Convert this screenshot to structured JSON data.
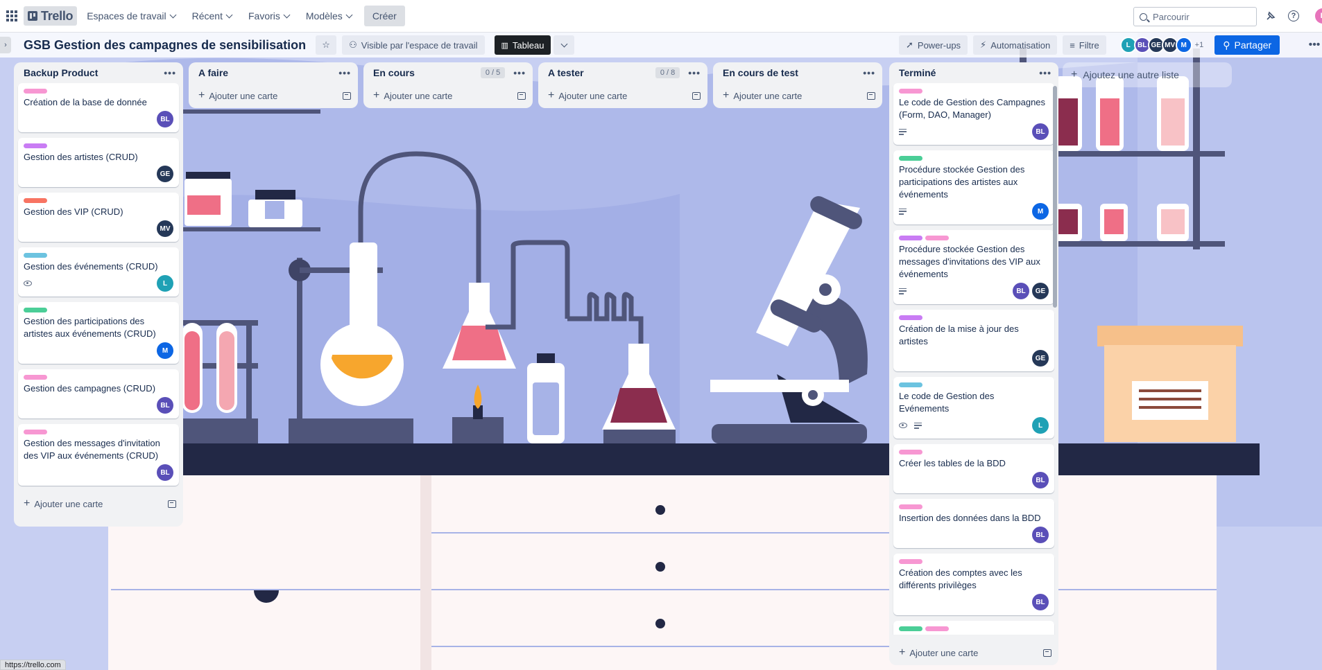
{
  "header": {
    "logo_text": "Trello",
    "nav": [
      {
        "label": "Espaces de travail"
      },
      {
        "label": "Récent"
      },
      {
        "label": "Favoris"
      },
      {
        "label": "Modèles"
      }
    ],
    "create_label": "Créer",
    "search_placeholder": "Parcourir",
    "user_initial": "L"
  },
  "board": {
    "title": "GSB Gestion des campagnes de sensibilisation",
    "visibility_label": "Visible par l'espace de travail",
    "view_tab_label": "Tableau",
    "powerups_label": "Power-ups",
    "automation_label": "Automatisation",
    "filter_label": "Filtre",
    "members": [
      {
        "initials": "L",
        "color": "#1fa1b5"
      },
      {
        "initials": "BL",
        "color": "#5a4fb8"
      },
      {
        "initials": "GE",
        "color": "#253858"
      },
      {
        "initials": "MV",
        "color": "#253858"
      },
      {
        "initials": "M",
        "color": "#0c66e4"
      }
    ],
    "members_more": "+1",
    "share_label": "Partager",
    "add_list_label": "Ajoutez une autre liste"
  },
  "add_card_label": "Ajouter une carte",
  "lists": [
    {
      "name": "Backup Product",
      "count": "",
      "cards": [
        {
          "labels": [
            "#f797d2"
          ],
          "title": "Création de la base de donnée",
          "badges": [],
          "members": [
            {
              "initials": "BL",
              "color": "#5a4fb8"
            }
          ]
        },
        {
          "labels": [
            "#c97cf4"
          ],
          "title": "Gestion des artistes (CRUD)",
          "badges": [],
          "members": [
            {
              "initials": "GE",
              "color": "#253858"
            }
          ]
        },
        {
          "labels": [
            "#f87462"
          ],
          "title": "Gestion des VIP (CRUD)",
          "badges": [],
          "members": [
            {
              "initials": "MV",
              "color": "#253858"
            }
          ]
        },
        {
          "labels": [
            "#6cc3e0"
          ],
          "title": "Gestion des événements (CRUD)",
          "badges": [
            "eye"
          ],
          "members": [
            {
              "initials": "L",
              "color": "#1fa1b5"
            }
          ]
        },
        {
          "labels": [
            "#4bce97"
          ],
          "title": "Gestion des participations des artistes aux événements (CRUD)",
          "badges": [],
          "members": [
            {
              "initials": "M",
              "color": "#0c66e4"
            }
          ]
        },
        {
          "labels": [
            "#f797d2"
          ],
          "title": "Gestion des campagnes (CRUD)",
          "badges": [],
          "members": [
            {
              "initials": "BL",
              "color": "#5a4fb8"
            }
          ]
        },
        {
          "labels": [
            "#f797d2"
          ],
          "title": "Gestion des messages d'invitation des VIP aux événements (CRUD)",
          "badges": [],
          "members": [
            {
              "initials": "BL",
              "color": "#5a4fb8"
            }
          ]
        }
      ]
    },
    {
      "name": "A faire",
      "count": "",
      "cards": []
    },
    {
      "name": "En cours",
      "count": "0 / 5",
      "cards": []
    },
    {
      "name": "A tester",
      "count": "0 / 8",
      "cards": []
    },
    {
      "name": "En cours de test",
      "count": "",
      "cards": []
    },
    {
      "name": "Terminé",
      "count": "",
      "cards": [
        {
          "labels": [
            "#f797d2"
          ],
          "title": "Le code de Gestion des Campagnes (Form, DAO, Manager)",
          "badges": [
            "desc"
          ],
          "members": [
            {
              "initials": "BL",
              "color": "#5a4fb8"
            }
          ]
        },
        {
          "labels": [
            "#4bce97"
          ],
          "title": "Procédure stockée Gestion des participations des artistes aux événements",
          "badges": [
            "desc"
          ],
          "members": [
            {
              "initials": "M",
              "color": "#0c66e4"
            }
          ]
        },
        {
          "labels": [
            "#c97cf4",
            "#f797d2"
          ],
          "title": "Procédure stockée Gestion des messages d'invitations des VIP aux événements",
          "badges": [
            "desc"
          ],
          "members": [
            {
              "initials": "BL",
              "color": "#5a4fb8"
            },
            {
              "initials": "GE",
              "color": "#253858"
            }
          ]
        },
        {
          "labels": [
            "#c97cf4"
          ],
          "title": "Création de la mise à jour des artistes",
          "badges": [],
          "members": [
            {
              "initials": "GE",
              "color": "#253858"
            }
          ]
        },
        {
          "labels": [
            "#6cc3e0"
          ],
          "title": "Le code de Gestion des Evénements",
          "badges": [
            "eye",
            "desc"
          ],
          "members": [
            {
              "initials": "L",
              "color": "#1fa1b5"
            }
          ]
        },
        {
          "labels": [
            "#f797d2"
          ],
          "title": "Créer les tables de la BDD",
          "badges": [],
          "members": [
            {
              "initials": "BL",
              "color": "#5a4fb8"
            }
          ]
        },
        {
          "labels": [
            "#f797d2"
          ],
          "title": "Insertion des données dans la BDD",
          "badges": [],
          "members": [
            {
              "initials": "BL",
              "color": "#5a4fb8"
            }
          ]
        },
        {
          "labels": [
            "#f797d2"
          ],
          "title": "Création des comptes avec les différents privilèges",
          "badges": [],
          "members": [
            {
              "initials": "BL",
              "color": "#5a4fb8"
            }
          ]
        },
        {
          "labels": [
            "#4bce97",
            "#f797d2"
          ],
          "title": "",
          "badges": [],
          "members": []
        }
      ]
    }
  ],
  "status_url": "https://trello.com"
}
